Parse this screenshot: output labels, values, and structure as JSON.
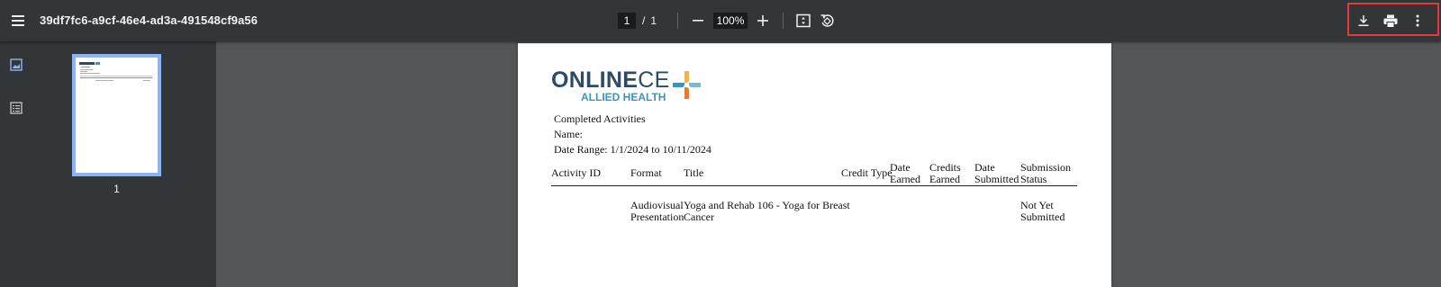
{
  "toolbar": {
    "title": "39df7fc6-a9cf-46e4-ad3a-491548cf9a56",
    "page_current": "1",
    "page_sep": "/",
    "page_total": "1",
    "zoom": "100%",
    "icons": [
      "menu-icon",
      "zoom-out-icon",
      "zoom-in-icon",
      "fit-page-icon",
      "rotate-icon",
      "download-icon",
      "print-icon",
      "more-icon"
    ]
  },
  "sidebar": {
    "thumbnail_label": "1",
    "tabs": [
      "thumbnails-icon",
      "outline-icon"
    ]
  },
  "document": {
    "logo": {
      "main_bold": "ONLINE",
      "main_light": "CE",
      "sub": "ALLIED HEALTH"
    },
    "heading": "Completed Activities",
    "name_label": "Name:",
    "date_range": "Date Range: 1/1/2024 to 10/11/2024",
    "columns": {
      "activity_id": "Activity ID",
      "format": "Format",
      "title": "Title",
      "credit_type": "Credit Type",
      "date_earned_1": "Date",
      "date_earned_2": "Earned",
      "credits_earned_1": "Credits",
      "credits_earned_2": "Earned",
      "date_submitted_1": "Date",
      "date_submitted_2": "Submitted",
      "status_1": "Submission",
      "status_2": "Status"
    },
    "row": {
      "format_1": "Audiovisual",
      "format_2": "Presentation",
      "title_1": "Yoga and Rehab 106 - Yoga for Breast",
      "title_2": "Cancer",
      "status_1": "Not Yet",
      "status_2": "Submitted"
    }
  },
  "colors": {
    "toolbar_bg": "#323639",
    "canvas_bg": "#525659",
    "thumb_border": "#8ab4f8",
    "highlight": "#e53935",
    "logo_navy": "#2d4a66",
    "logo_teal": "#3b95b8"
  }
}
